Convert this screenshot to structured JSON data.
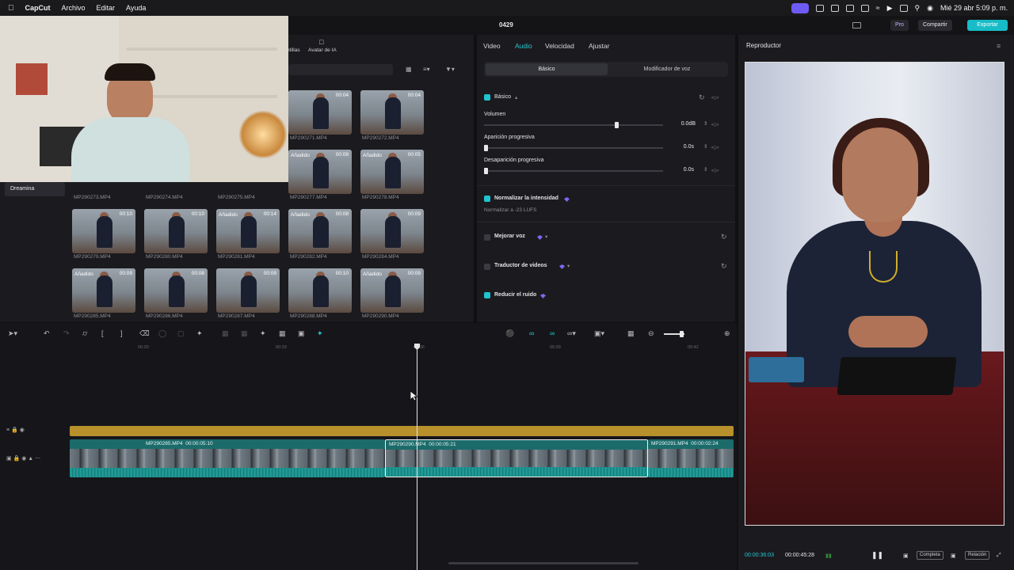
{
  "menubar": {
    "app_name": "CapCut",
    "menus": [
      "Archivo",
      "Editar",
      "Ayuda"
    ],
    "clock": "Mié 29 abr  5:09 p. m."
  },
  "appbar": {
    "project_title": "0429",
    "pro_label": "Pro",
    "share_label": "Compartir",
    "export_label": "Exportar"
  },
  "media": {
    "top_tabs": [
      "ntillas",
      "Avatar de IA"
    ],
    "sidebar_item": "Dreamina",
    "added_label": "Añadido",
    "thumbs": [
      {
        "dur": "00:04",
        "name": "MP290271.MP4",
        "added": false
      },
      {
        "dur": "00:04",
        "name": "MP290272.MP4",
        "added": false
      },
      {
        "dur": "00:08",
        "name": "MP290277.MP4",
        "added": true
      },
      {
        "dur": "00:05",
        "name": "MP290278.MP4",
        "added": true
      },
      {
        "dur": "00:10",
        "name": "MP290279.MP4",
        "added": false
      },
      {
        "dur": "00:10",
        "name": "MP290280.MP4",
        "added": false
      },
      {
        "dur": "00:14",
        "name": "MP290281.MP4",
        "added": true
      },
      {
        "dur": "00:08",
        "name": "MP290282.MP4",
        "added": true
      },
      {
        "dur": "00:09",
        "name": "MP290284.MP4",
        "added": false
      },
      {
        "dur": "00:09",
        "name": "MP290285.MP4",
        "added": true
      },
      {
        "dur": "00:08",
        "name": "MP290286.MP4",
        "added": false
      },
      {
        "dur": "00:09",
        "name": "MP290287.MP4",
        "added": false
      },
      {
        "dur": "00:10",
        "name": "MP290288.MP4",
        "added": false
      },
      {
        "dur": "00:09",
        "name": "MP290290.MP4",
        "added": true
      }
    ],
    "partial_names": [
      "MP290273.MP4",
      "MP290274.MP4",
      "MP290275.MP4"
    ]
  },
  "props": {
    "tabs": [
      "Video",
      "Audio",
      "Velocidad",
      "Ajustar"
    ],
    "active_tab": "Audio",
    "seg_basic": "Básico",
    "seg_voice": "Modificador de voz",
    "section_basic": "Básico",
    "volume_label": "Volumen",
    "volume_value": "0.0dB",
    "fade_in_label": "Aparición progresiva",
    "fade_in_value": "0.0s",
    "fade_out_label": "Desaparición progresiva",
    "fade_out_value": "0.0s",
    "normalize_label": "Normalizar la intensidad",
    "normalize_sub": "Normalizar a -23 LUFS",
    "enhance_label": "Mejorar voz",
    "translate_label": "Traductor de videos",
    "denoise_label": "Reducir el ruido"
  },
  "timeline": {
    "ruler": [
      "00:30",
      "00:33",
      "00:36",
      "00:39",
      "00:42"
    ],
    "clips": [
      {
        "name": "MP290285.MP4",
        "dur": "00:00:05:10"
      },
      {
        "name": "MP290290.MP4",
        "dur": "00:00:05:21"
      },
      {
        "name": "MP290291.MP4",
        "dur": "00:00:02:24"
      }
    ]
  },
  "player": {
    "title": "Reproductor",
    "current_time": "00:00:36:03",
    "total_time": "00:00:45:28",
    "complete_label": "Completa",
    "ratio_label": "Relación"
  },
  "colors": {
    "accent": "#1fc4cf",
    "export": "#18bcc7",
    "audio_track": "#b8902c",
    "video_clip": "#1c6b6b"
  }
}
